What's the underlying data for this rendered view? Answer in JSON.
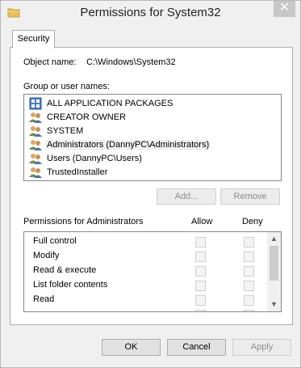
{
  "window": {
    "title": "Permissions for System32",
    "close_glyph": "✕",
    "icon": "folder-icon"
  },
  "tabs": [
    {
      "label": "Security",
      "active": true
    }
  ],
  "object": {
    "label": "Object name:",
    "value": "C:\\Windows\\System32"
  },
  "groups": {
    "label": "Group or user names:",
    "items": [
      {
        "label": "ALL APPLICATION PACKAGES",
        "icon": "app-packages-icon",
        "selected": false
      },
      {
        "label": "CREATOR OWNER",
        "icon": "users-icon",
        "selected": false
      },
      {
        "label": "SYSTEM",
        "icon": "users-icon",
        "selected": false
      },
      {
        "label": "Administrators (DannyPC\\Administrators)",
        "icon": "users-icon",
        "selected": true
      },
      {
        "label": "Users (DannyPC\\Users)",
        "icon": "users-icon",
        "selected": false
      },
      {
        "label": "TrustedInstaller",
        "icon": "users-icon",
        "selected": false
      }
    ]
  },
  "group_buttons": {
    "add": "Add...",
    "remove": "Remove"
  },
  "permissions": {
    "label": "Permissions for Administrators",
    "allow_header": "Allow",
    "deny_header": "Deny",
    "rows": [
      {
        "name": "Full control",
        "allow": false,
        "deny": false
      },
      {
        "name": "Modify",
        "allow": false,
        "deny": false
      },
      {
        "name": "Read & execute",
        "allow": false,
        "deny": false
      },
      {
        "name": "List folder contents",
        "allow": false,
        "deny": false
      },
      {
        "name": "Read",
        "allow": false,
        "deny": false
      },
      {
        "name": "",
        "allow": false,
        "deny": false
      }
    ]
  },
  "scrollbar": {
    "up_glyph": "▲",
    "down_glyph": "▼"
  },
  "footer": {
    "ok": "OK",
    "cancel": "Cancel",
    "apply": "Apply"
  }
}
